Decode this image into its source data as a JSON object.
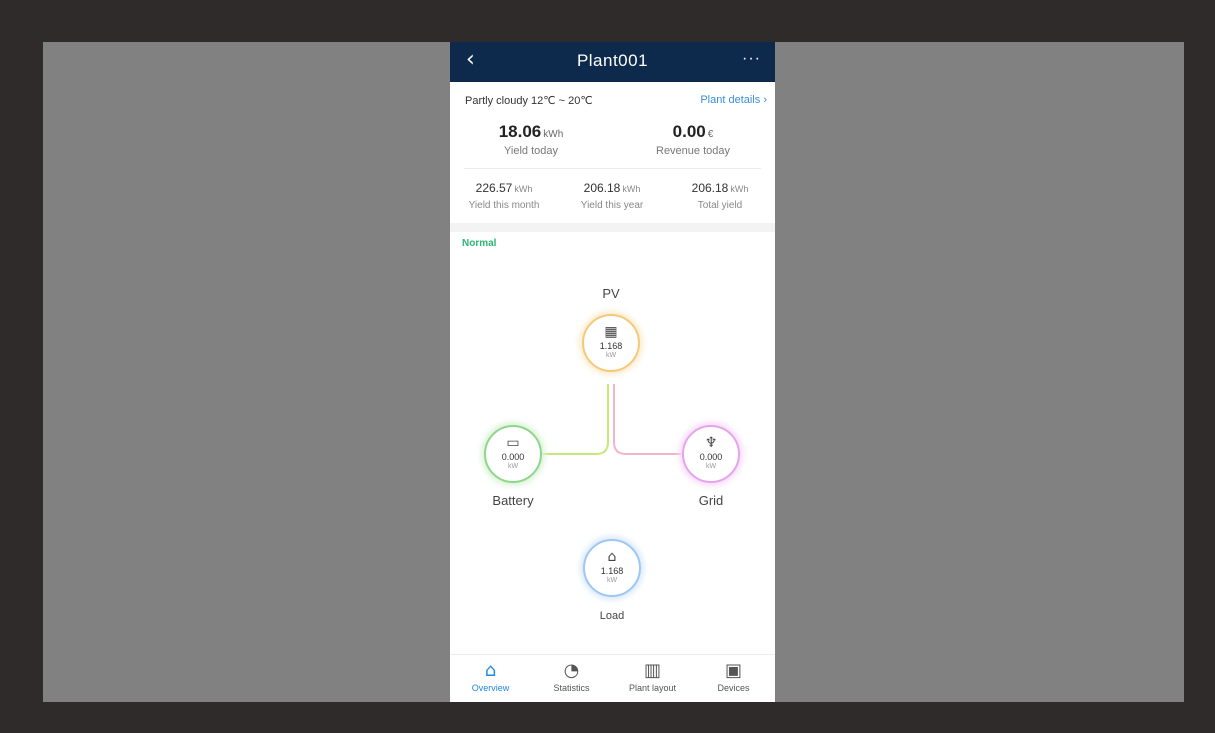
{
  "header": {
    "title": "Plant001",
    "back_icon": "chevron-left-icon",
    "more_label": "···"
  },
  "summary": {
    "weather": "Partly cloudy 12℃ ~ 20℃",
    "plant_details": "Plant details",
    "yield_today": {
      "value": "18.06",
      "unit": "kWh",
      "label": "Yield today"
    },
    "revenue_today": {
      "value": "0.00",
      "unit": "€",
      "label": "Revenue today"
    },
    "yield_month": {
      "value": "226.57",
      "unit": "kWh",
      "label": "Yield this month"
    },
    "yield_year": {
      "value": "206.18",
      "unit": "kWh",
      "label": "Yield this year"
    },
    "total_yield": {
      "value": "206.18",
      "unit": "kWh",
      "label": "Total yield"
    }
  },
  "status": "Normal",
  "flow": {
    "pv": {
      "label": "PV",
      "value": "1.168",
      "unit": "kW",
      "icon": "solar-panel-icon",
      "color": "#f5c978"
    },
    "battery": {
      "label": "Battery",
      "value": "0.000",
      "unit": "kW",
      "icon": "battery-icon",
      "color": "#8fd68a"
    },
    "grid": {
      "label": "Grid",
      "value": "0.000",
      "unit": "kW",
      "icon": "power-tower-icon",
      "color": "#e6a3ee"
    },
    "load": {
      "label": "Load",
      "value": "1.168",
      "unit": "kW",
      "icon": "house-icon",
      "color": "#9cc8f2"
    }
  },
  "nav": [
    {
      "label": "Overview",
      "icon": "house-icon",
      "active": true
    },
    {
      "label": "Statistics",
      "icon": "pie-chart-icon",
      "active": false
    },
    {
      "label": "Plant layout",
      "icon": "layout-icon",
      "active": false
    },
    {
      "label": "Devices",
      "icon": "devices-icon",
      "active": false
    }
  ]
}
